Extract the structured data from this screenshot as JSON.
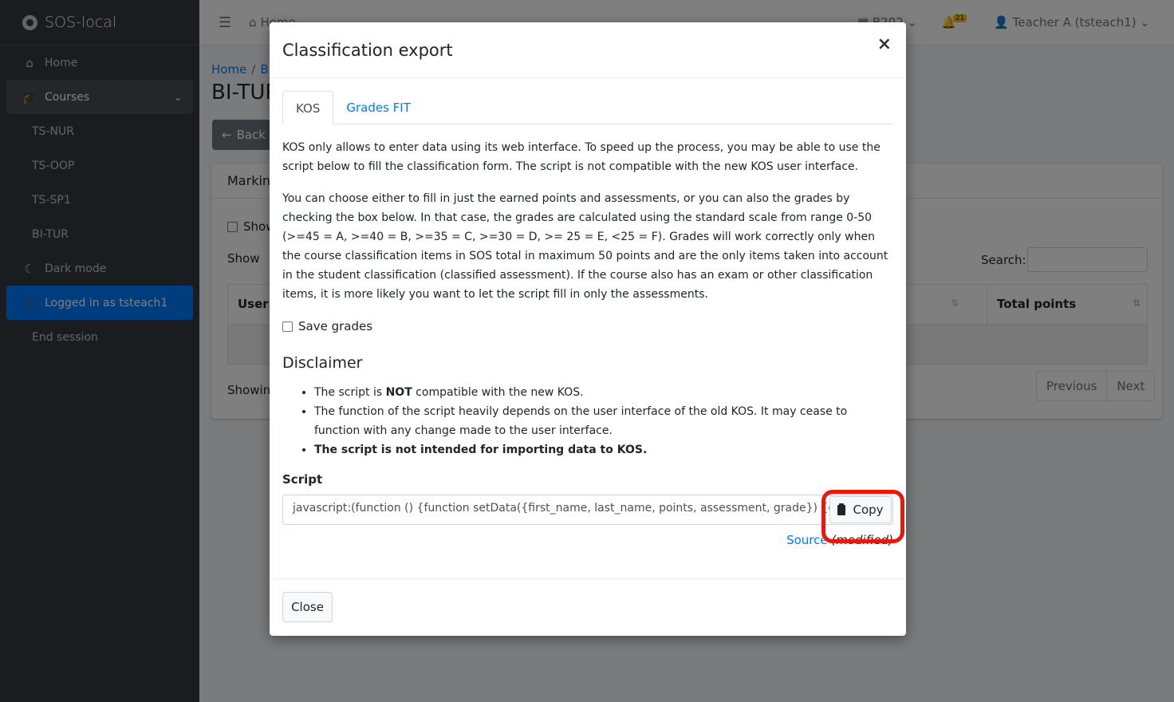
{
  "app": {
    "brand": "SOS-local"
  },
  "sidebar": {
    "items": [
      {
        "label": "Home",
        "icon": "home-icon"
      },
      {
        "label": "Courses",
        "icon": "graduation-cap-icon"
      },
      {
        "label": "TS-NUR"
      },
      {
        "label": "TS-OOP"
      },
      {
        "label": "TS-SP1"
      },
      {
        "label": "BI-TUR"
      },
      {
        "label": "Dark mode",
        "icon": "moon-icon"
      },
      {
        "label": "Logged in as tsteach1",
        "icon": "user-cog-icon"
      },
      {
        "label": "End session"
      }
    ]
  },
  "topbar": {
    "home": "Home",
    "room": "B202",
    "notifications": "21",
    "user": "Teacher A (tsteach1)"
  },
  "page": {
    "breadcrumb": [
      "Home",
      "B"
    ],
    "title": "BI-TUR",
    "back_label": "Back",
    "card_title": "Marking",
    "show_checkbox_label": "Show",
    "show_entries": "Show",
    "search_label": "Search:",
    "col_username": "Usern",
    "col_total": "Total points",
    "showing": "Showin",
    "prev": "Previous",
    "next": "Next"
  },
  "modal": {
    "title": "Classification export",
    "close_x": "×",
    "tabs": [
      "KOS",
      "Grades FIT"
    ],
    "p1": "KOS only allows to enter data using its web interface. To speed up the process, you may be able to use the script below to fill the classification form. The script is not compatible with the new KOS user interface.",
    "p2": "You can choose either to fill in just the earned points and assessments, or you can also the grades by checking the box below. In that case, the grades are calculated using the standard scale from range 0-50 (>=45 = A, >=40 = B, >=35 = C, >=30 = D, >= 25 = E, <25 = F). Grades will work correctly only when the course classification items in SOS total in maximum 50 points and are the only items taken into account in the student classification (classified assessment). If the course also has an exam or other classification items, it is more likely you want to let the script fill in only the assessments.",
    "save_grades_label": "Save grades",
    "disclaimer_title": "Disclaimer",
    "disc1_pre": "The script is ",
    "disc1_bold": "NOT",
    "disc1_post": " compatible with the new KOS.",
    "disc2": "The function of the script heavily depends on the user interface of the old KOS. It may cease to function with any change made to the user interface.",
    "disc3": "The script is not intended for importing data to KOS.",
    "script_label": "Script",
    "script_value": "javascript:(function () {function setData({first_name, last_name, points, assessment, grade}) {consol",
    "copy_label": "Copy",
    "source_link": "Source",
    "source_note": "(modified)",
    "close_label": "Close"
  },
  "colors": {
    "sidebar": "#343a40",
    "accent": "#007bff",
    "highlight": "#e8190c"
  }
}
